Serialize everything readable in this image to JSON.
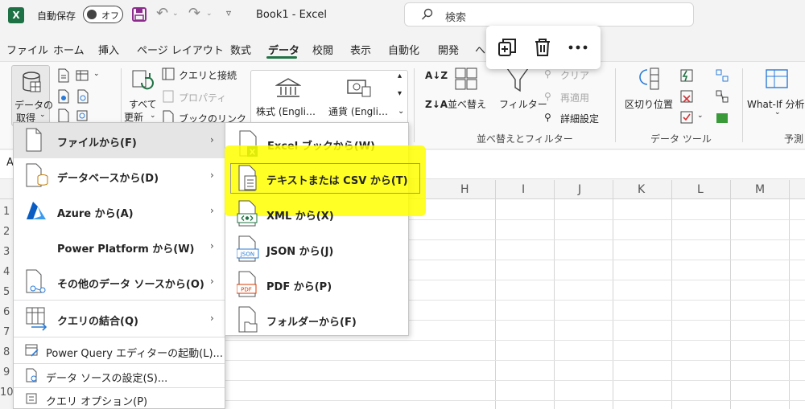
{
  "titlebar": {
    "autosave_label": "自動保存",
    "autosave_state": "オフ",
    "doc_title": "Book1  -  Excel",
    "search_placeholder": "検索"
  },
  "tabs": [
    "ファイル",
    "ホーム",
    "挿入",
    "ページ レイアウト",
    "数式",
    "データ",
    "校閲",
    "表示",
    "自動化",
    "開発",
    "ヘ"
  ],
  "active_tab": "データ",
  "ribbon": {
    "get_data_line1": "データの",
    "get_data_line2": "取得",
    "queries_connections": "クエリと接続",
    "properties": "プロパティ",
    "workbook_links": "ブックのリンク",
    "refresh_all_line1": "すべて",
    "refresh_all_line2": "更新",
    "stocks": "株式 (Engli…",
    "currency": "通貨 (Engli…",
    "sort": "並べ替え",
    "filter": "フィルター",
    "clear": "クリア",
    "reapply": "再適用",
    "advanced": "詳細設定",
    "sort_filter_group": "並べ替えとフィルター",
    "text_to_columns": "区切り位置",
    "data_tools_group": "データ ツール",
    "what_if": "What-If 分析",
    "forecast_group": "予測"
  },
  "formula_bar": {
    "name_box_edge": "A"
  },
  "columns": [
    "H",
    "I",
    "J",
    "K",
    "L",
    "M"
  ],
  "rows": [
    "1",
    "2",
    "3",
    "4",
    "5",
    "6",
    "7",
    "8",
    "9",
    "10"
  ],
  "menu": {
    "items": [
      {
        "label": "ファイルから(F)",
        "icon": "file-icon"
      },
      {
        "label": "データベースから(D)",
        "icon": "database-icon"
      },
      {
        "label": "Azure から(A)",
        "icon": "azure-icon"
      },
      {
        "label": "Power Platform から(W)",
        "icon": "power-platform-icon"
      },
      {
        "label": "その他のデータ ソースから(O)",
        "icon": "other-sources-icon"
      },
      {
        "label": "クエリの結合(Q)",
        "icon": "combine-queries-icon"
      }
    ],
    "plain_items": [
      {
        "label": "Power Query エディターの起動(L)...",
        "icon": "power-query-editor-icon"
      },
      {
        "label": "データ ソースの設定(S)...",
        "icon": "data-source-settings-icon"
      },
      {
        "label": "クエリ オプション(P)",
        "icon": "query-options-icon"
      }
    ]
  },
  "submenu": {
    "items": [
      {
        "label": "Excel ブックから(W)",
        "icon": "excel-workbook-icon"
      },
      {
        "label": "テキストまたは CSV から(T)",
        "icon": "text-csv-icon"
      },
      {
        "label": "XML から(X)",
        "icon": "xml-icon"
      },
      {
        "label": "JSON から(J)",
        "icon": "json-icon"
      },
      {
        "label": "PDF から(P)",
        "icon": "pdf-icon"
      },
      {
        "label": "フォルダーから(F)",
        "icon": "folder-icon"
      }
    ]
  },
  "icon_labels": {
    "excel_x": "X",
    "json": "JSON",
    "pdf": "PDF"
  },
  "colors": {
    "excel_green": "#217346",
    "highlight": "#ffff00",
    "pdf_red": "#d83b01"
  }
}
